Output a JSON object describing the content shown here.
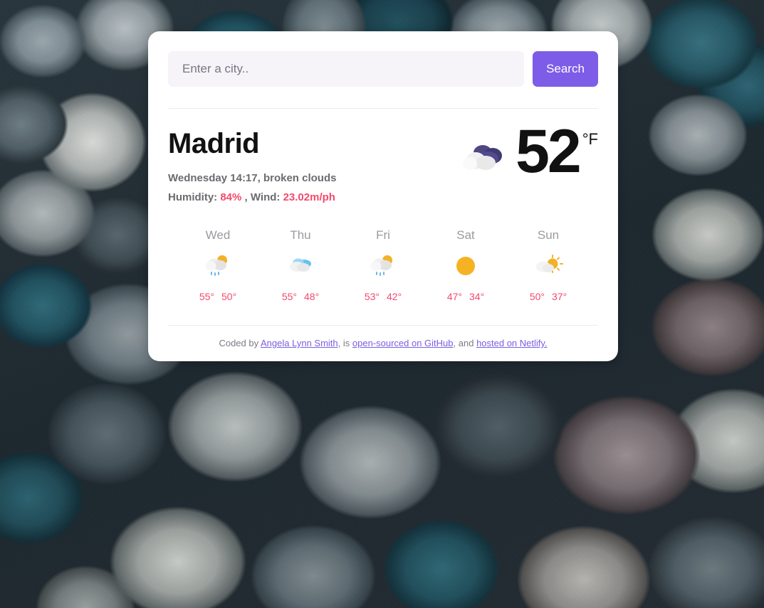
{
  "search": {
    "placeholder": "Enter a city..",
    "value": "",
    "button_label": "Search"
  },
  "current": {
    "city": "Madrid",
    "datetime_description": "Wednesday 14:17, broken clouds",
    "humidity_label": "Humidity:",
    "humidity_value": "84%",
    "separator": ", Wind:",
    "wind_value": "23.02m/ph",
    "temperature": "52",
    "unit": "°F",
    "icon": "broken-clouds-icon"
  },
  "forecast": [
    {
      "day": "Wed",
      "icon": "sun-cloud-rain-icon",
      "high": "55°",
      "low": "50°"
    },
    {
      "day": "Thu",
      "icon": "cloud-icon",
      "high": "55°",
      "low": "48°"
    },
    {
      "day": "Fri",
      "icon": "sun-cloud-rain-icon",
      "high": "53°",
      "low": "42°"
    },
    {
      "day": "Sat",
      "icon": "sun-icon",
      "high": "47°",
      "low": "34°"
    },
    {
      "day": "Sun",
      "icon": "sun-cloud-icon",
      "high": "50°",
      "low": "37°"
    }
  ],
  "footer": {
    "prefix": "Coded by ",
    "author_link": "Angela Lynn Smith",
    "mid1": ", is ",
    "github_link": "open-sourced on GitHub",
    "mid2": ", and ",
    "netlify_link": "hosted on Netlify."
  },
  "colors": {
    "accent_purple": "#7d5ce8",
    "accent_pink": "#f4496e",
    "link_purple": "#7b5de0",
    "card_bg": "#ffffff",
    "input_bg": "#f6f3f9"
  }
}
